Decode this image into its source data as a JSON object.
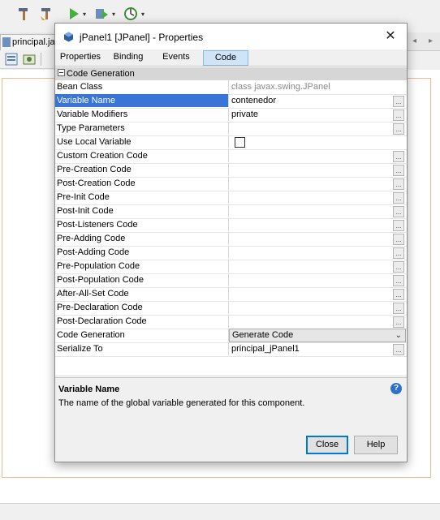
{
  "ide": {
    "file_tab": "principal.java",
    "toolbar_icons": [
      "hammer-icon",
      "clean-build-icon",
      "run-icon",
      "debug-icon",
      "profile-icon"
    ]
  },
  "dialog": {
    "title": "jPanel1 [JPanel] - Properties",
    "close_glyph": "✕",
    "tabs": [
      "Properties",
      "Binding",
      "Events",
      "Code"
    ],
    "active_tab": "Code",
    "section": "Code Generation",
    "properties": [
      {
        "name": "Bean Class",
        "value": "class javax.swing.JPanel"
      },
      {
        "name": "Variable Name",
        "value": "contenedor"
      },
      {
        "name": "Variable Modifiers",
        "value": "private"
      },
      {
        "name": "Type Parameters",
        "value": ""
      },
      {
        "name": "Use Local Variable",
        "value": ""
      },
      {
        "name": "Custom Creation Code",
        "value": ""
      },
      {
        "name": "Pre-Creation Code",
        "value": ""
      },
      {
        "name": "Post-Creation Code",
        "value": ""
      },
      {
        "name": "Pre-Init Code",
        "value": ""
      },
      {
        "name": "Post-Init Code",
        "value": ""
      },
      {
        "name": "Post-Listeners Code",
        "value": ""
      },
      {
        "name": "Pre-Adding Code",
        "value": ""
      },
      {
        "name": "Post-Adding Code",
        "value": ""
      },
      {
        "name": "Pre-Population Code",
        "value": ""
      },
      {
        "name": "Post-Population Code",
        "value": ""
      },
      {
        "name": "After-All-Set Code",
        "value": ""
      },
      {
        "name": "Pre-Declaration Code",
        "value": ""
      },
      {
        "name": "Post-Declaration Code",
        "value": ""
      },
      {
        "name": "Code Generation",
        "value": "Generate Code"
      },
      {
        "name": "Serialize To",
        "value": "principal_jPanel1"
      }
    ],
    "ellipsis": "...",
    "description_title": "Variable Name",
    "description_text": "The name of the global variable generated for this component.",
    "help_glyph": "?",
    "close_button": "Close",
    "help_button": "Help"
  },
  "colors": {
    "selection": "#3875d7",
    "active_tab": "#cfe4f7",
    "frame_border": "#f4b98f"
  }
}
